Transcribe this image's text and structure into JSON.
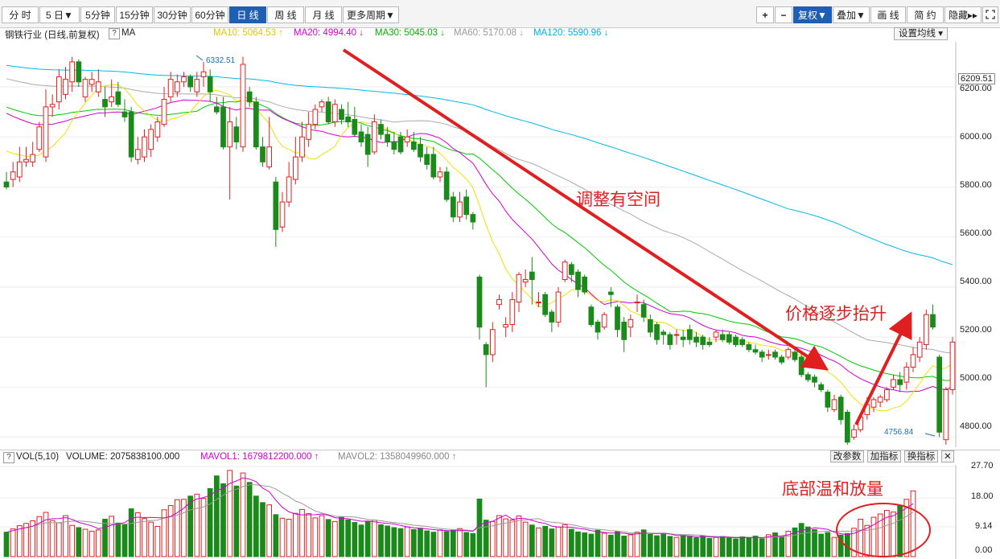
{
  "toolbar": {
    "periods": [
      "分 时",
      "5 日▼",
      "5分钟",
      "15分钟",
      "30分钟",
      "60分钟",
      "日 线",
      "周 线",
      "月 线",
      "更多周期▼"
    ],
    "active_period": "日 线",
    "zoom_in": "+",
    "zoom_out": "−",
    "right_buttons": [
      "复权▼",
      "叠加▼",
      "画 线",
      "简 约",
      "隐藏▸▸"
    ],
    "fullscreen_icon": "fullscreen-icon"
  },
  "legend": {
    "title": "钢铁行业 (日线,前复权)",
    "help": "?",
    "indicator": "MA",
    "ma10": "MA10: 5064.53 ↑",
    "ma20": "MA20: 4994.40 ↓",
    "ma30": "MA30: 5045.03 ↓",
    "ma60": "MA60: 5170.08 ↓",
    "ma120": "MA120: 5590.96 ↓",
    "settings": "设置均线 ▾"
  },
  "colors": {
    "up": "#e02020",
    "down": "#1a8a1a",
    "ma10": "#f0e000",
    "ma20": "#d000d0",
    "ma30": "#00c800",
    "ma60": "#aaaaaa",
    "ma120": "#00b8e8",
    "accent": "#1e5fb3"
  },
  "annotations": {
    "down_trend": "调整有空间",
    "up_trend": "价格逐步抬升",
    "volume_note": "底部温和放量"
  },
  "price_axis": {
    "ticks": [
      "6200.00",
      "6000.00",
      "5800.00",
      "5600.00",
      "5400.00",
      "5200.00",
      "5000.00",
      "4800.00"
    ],
    "current": "6209.51"
  },
  "volume_header": {
    "help": "?",
    "title": "VOL(5,10)",
    "volume": "VOLUME: 2075838100.000",
    "mavol1": "MAVOL1: 1679812200.000 ↑",
    "mavol2": "MAVOL2: 1358049960.000 ↑",
    "buttons": [
      "改参数",
      "加指标",
      "换指标"
    ],
    "close": "✕"
  },
  "volume_axis": {
    "ticks": [
      "27.70",
      "18.00",
      "9.14",
      "0.00"
    ]
  },
  "chart_data": {
    "type": "candlestick",
    "instrument": "钢铁行业",
    "period": "日线",
    "y_range": [
      4760,
      6380
    ],
    "high_marker": "6332.51",
    "low_marker": "4756.84",
    "ohlc": [
      [
        5820,
        5800,
        5860,
        5790
      ],
      [
        5830,
        5860,
        5900,
        5800
      ],
      [
        5840,
        5900,
        5960,
        5820
      ],
      [
        5900,
        5910,
        5960,
        5880
      ],
      [
        5900,
        5930,
        5980,
        5880
      ],
      [
        5950,
        6040,
        6060,
        5940
      ],
      [
        5920,
        6120,
        6190,
        5900
      ],
      [
        6120,
        6130,
        6170,
        6080
      ],
      [
        6140,
        6240,
        6270,
        6110
      ],
      [
        6170,
        6230,
        6280,
        6150
      ],
      [
        6220,
        6300,
        6320,
        6180
      ],
      [
        6300,
        6220,
        6310,
        6200
      ],
      [
        6160,
        6230,
        6240,
        6140
      ],
      [
        6210,
        6230,
        6260,
        6180
      ],
      [
        6180,
        6220,
        6270,
        6160
      ],
      [
        6150,
        6120,
        6200,
        6080
      ],
      [
        6140,
        6160,
        6230,
        6120
      ],
      [
        6180,
        6130,
        6220,
        6120
      ],
      [
        6100,
        6080,
        6150,
        6060
      ],
      [
        6100,
        5920,
        6120,
        5900
      ],
      [
        5910,
        5950,
        6000,
        5890
      ],
      [
        5920,
        6000,
        6030,
        5900
      ],
      [
        5950,
        6030,
        6050,
        5920
      ],
      [
        6000,
        6060,
        6080,
        5980
      ],
      [
        6050,
        6150,
        6200,
        6040
      ],
      [
        6160,
        6230,
        6260,
        6140
      ],
      [
        6180,
        6220,
        6250,
        6160
      ],
      [
        6220,
        6240,
        6260,
        6200
      ],
      [
        6240,
        6200,
        6250,
        6180
      ],
      [
        6180,
        6230,
        6260,
        6160
      ],
      [
        6240,
        6260,
        6300,
        6200
      ],
      [
        6240,
        6180,
        6270,
        6140
      ],
      [
        6120,
        6100,
        6160,
        6090
      ],
      [
        6120,
        5960,
        6160,
        5950
      ],
      [
        5960,
        6060,
        6120,
        5750
      ],
      [
        6040,
        5980,
        6080,
        5950
      ],
      [
        5960,
        6290,
        6320,
        5940
      ],
      [
        6180,
        6140,
        6200,
        6120
      ],
      [
        6140,
        5960,
        6160,
        5950
      ],
      [
        5960,
        5900,
        6000,
        5880
      ],
      [
        5880,
        5960,
        6080,
        5870
      ],
      [
        5820,
        5630,
        5840,
        5560
      ],
      [
        5640,
        5740,
        5780,
        5620
      ],
      [
        5740,
        5840,
        5900,
        5720
      ],
      [
        5830,
        5920,
        6000,
        5810
      ],
      [
        5920,
        6000,
        6060,
        5900
      ],
      [
        5990,
        6050,
        6100,
        5960
      ],
      [
        6050,
        6110,
        6130,
        6030
      ],
      [
        6120,
        6140,
        6150,
        6100
      ],
      [
        6140,
        6060,
        6160,
        6050
      ],
      [
        6060,
        6130,
        6150,
        6040
      ],
      [
        6110,
        6070,
        6130,
        6050
      ],
      [
        6080,
        6060,
        6140,
        6040
      ],
      [
        6070,
        6010,
        6120,
        6000
      ],
      [
        6020,
        5980,
        6050,
        5960
      ],
      [
        6010,
        5930,
        6040,
        5880
      ],
      [
        5940,
        6060,
        6090,
        5930
      ],
      [
        6050,
        6010,
        6070,
        5990
      ],
      [
        6010,
        5980,
        6040,
        5960
      ],
      [
        5980,
        5950,
        6020,
        5930
      ],
      [
        6000,
        5940,
        6020,
        5930
      ],
      [
        5980,
        6000,
        6030,
        5960
      ],
      [
        5980,
        5950,
        6020,
        5940
      ],
      [
        5970,
        5920,
        6000,
        5900
      ],
      [
        5930,
        5890,
        5960,
        5870
      ],
      [
        5930,
        5840,
        5960,
        5830
      ],
      [
        5840,
        5860,
        5880,
        5820
      ],
      [
        5860,
        5750,
        5880,
        5740
      ],
      [
        5760,
        5680,
        5780,
        5660
      ],
      [
        5680,
        5740,
        5780,
        5660
      ],
      [
        5760,
        5690,
        5790,
        5670
      ],
      [
        5690,
        5660,
        5700,
        5630
      ],
      [
        5440,
        5240,
        5450,
        5190
      ],
      [
        5170,
        5130,
        5180,
        5000
      ],
      [
        5130,
        5230,
        5260,
        5100
      ],
      [
        5330,
        5350,
        5370,
        5310
      ],
      [
        5240,
        5250,
        5280,
        5200
      ],
      [
        5250,
        5350,
        5380,
        5220
      ],
      [
        5340,
        5450,
        5460,
        5300
      ],
      [
        5420,
        5430,
        5470,
        5400
      ],
      [
        5460,
        5430,
        5520,
        5330
      ],
      [
        5340,
        5340,
        5380,
        5320
      ],
      [
        5370,
        5290,
        5380,
        5280
      ],
      [
        5300,
        5260,
        5310,
        5220
      ],
      [
        5260,
        5380,
        5400,
        5240
      ],
      [
        5430,
        5500,
        5510,
        5420
      ],
      [
        5490,
        5450,
        5500,
        5420
      ],
      [
        5460,
        5390,
        5470,
        5360
      ],
      [
        5440,
        5380,
        5450,
        5370
      ],
      [
        5320,
        5250,
        5330,
        5240
      ],
      [
        5260,
        5220,
        5270,
        5190
      ],
      [
        5240,
        5290,
        5300,
        5230
      ],
      [
        5380,
        5370,
        5400,
        5320
      ],
      [
        5320,
        5230,
        5330,
        5200
      ],
      [
        5260,
        5190,
        5280,
        5140
      ],
      [
        5240,
        5270,
        5290,
        5200
      ],
      [
        5340,
        5340,
        5370,
        5300
      ],
      [
        5330,
        5280,
        5350,
        5260
      ],
      [
        5270,
        5220,
        5290,
        5200
      ],
      [
        5250,
        5190,
        5260,
        5170
      ],
      [
        5220,
        5210,
        5230,
        5170
      ],
      [
        5210,
        5170,
        5220,
        5150
      ],
      [
        5210,
        5210,
        5230,
        5170
      ],
      [
        5200,
        5190,
        5230,
        5160
      ],
      [
        5230,
        5190,
        5250,
        5170
      ],
      [
        5200,
        5180,
        5220,
        5160
      ],
      [
        5200,
        5170,
        5210,
        5150
      ],
      [
        5180,
        5170,
        5200,
        5160
      ],
      [
        5200,
        5220,
        5230,
        5180
      ],
      [
        5210,
        5190,
        5230,
        5180
      ],
      [
        5210,
        5180,
        5220,
        5170
      ],
      [
        5200,
        5170,
        5210,
        5160
      ],
      [
        5190,
        5170,
        5200,
        5160
      ],
      [
        5170,
        5150,
        5180,
        5140
      ],
      [
        5150,
        5140,
        5170,
        5130
      ],
      [
        5140,
        5120,
        5150,
        5100
      ],
      [
        5130,
        5130,
        5150,
        5110
      ],
      [
        5140,
        5120,
        5150,
        5110
      ],
      [
        5120,
        5100,
        5130,
        5090
      ],
      [
        5120,
        5150,
        5160,
        5110
      ],
      [
        5140,
        5110,
        5150,
        5100
      ],
      [
        5120,
        5050,
        5140,
        5040
      ],
      [
        5050,
        5030,
        5060,
        5020
      ],
      [
        5040,
        5020,
        5050,
        5000
      ],
      [
        5010,
        4990,
        5020,
        4980
      ],
      [
        4980,
        4920,
        4990,
        4900
      ],
      [
        4910,
        4950,
        4970,
        4900
      ],
      [
        4960,
        4870,
        4970,
        4850
      ],
      [
        4900,
        4780,
        4910,
        4770
      ],
      [
        4800,
        4830,
        4850,
        4790
      ],
      [
        4830,
        4880,
        4890,
        4820
      ],
      [
        4890,
        4930,
        4960,
        4870
      ],
      [
        4920,
        4950,
        4960,
        4900
      ],
      [
        4940,
        4960,
        4970,
        4920
      ],
      [
        4950,
        4990,
        5000,
        4940
      ],
      [
        5000,
        5030,
        5050,
        4990
      ],
      [
        5030,
        5010,
        5060,
        4980
      ],
      [
        5020,
        5080,
        5100,
        4990
      ],
      [
        5080,
        5130,
        5160,
        5060
      ],
      [
        5120,
        5180,
        5200,
        5100
      ],
      [
        5170,
        5290,
        5310,
        5150
      ],
      [
        5290,
        5240,
        5330,
        5230
      ],
      [
        5120,
        4820,
        5130,
        4800
      ],
      [
        4790,
        4990,
        5000,
        4770
      ],
      [
        4990,
        5180,
        5200,
        4970
      ]
    ],
    "volume": [
      7.5,
      8.5,
      9.5,
      10.2,
      11,
      12.3,
      13.6,
      11.1,
      10.4,
      12.6,
      9.6,
      8.9,
      8.4,
      7.8,
      8.2,
      11.5,
      12.4,
      10.3,
      9.8,
      14.7,
      13.5,
      11.7,
      10.6,
      9.3,
      14.4,
      15.7,
      17.5,
      17.6,
      18.6,
      19.2,
      17.9,
      20.9,
      24.8,
      22.4,
      26.5,
      21.7,
      25.7,
      22.8,
      18.6,
      16.6,
      15.9,
      12.9,
      11.8,
      11.5,
      13.3,
      14.5,
      13.2,
      11.9,
      12.6,
      11.4,
      10.8,
      12.1,
      11.3,
      10.5,
      9.7,
      10.9,
      11.2,
      9.8,
      9.4,
      8.9,
      8.6,
      9.1,
      8.3,
      8.7,
      7.9,
      7.5,
      8.2,
      7.7,
      8.1,
      8.6,
      7.4,
      7.1,
      17.7,
      11.2,
      10.8,
      12.6,
      11.6,
      11.2,
      12.5,
      10.6,
      9.7,
      8.8,
      9.3,
      8.5,
      9.1,
      9.8,
      8.4,
      7.6,
      7.3,
      6.9,
      8.1,
      7.2,
      6.6,
      7.7,
      6.3,
      6.7,
      7.5,
      8.2,
      6.8,
      6.4,
      7.1,
      6.2,
      5.9,
      6.5,
      6.1,
      5.8,
      6.4,
      5.6,
      5.9,
      6.2,
      5.7,
      5.4,
      6.1,
      5.8,
      6.3,
      5.5,
      6.7,
      7.3,
      6.1,
      7.8,
      8.8,
      10.2,
      9.1,
      8.3,
      6.9,
      7.4,
      5.9,
      6.6,
      7.1,
      8.7,
      11.5,
      9.6,
      12.1,
      13.1,
      14.2,
      13.7,
      15.8,
      17.6,
      20.2
    ]
  }
}
